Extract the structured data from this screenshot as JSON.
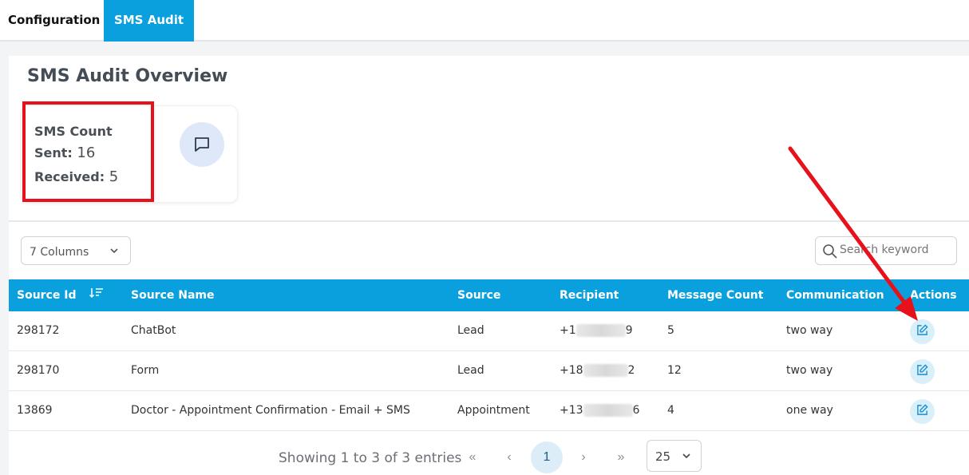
{
  "tabs": [
    {
      "label": "Configuration",
      "active": false
    },
    {
      "label": "SMS Audit",
      "active": true
    }
  ],
  "overview": {
    "title": "SMS Audit Overview",
    "card": {
      "heading": "SMS Count",
      "sent_label": "Sent:",
      "sent_value": "16",
      "received_label": "Received:",
      "received_value": "5",
      "icon": "message-icon"
    }
  },
  "toolbar": {
    "columns_label": "7 Columns",
    "search_placeholder": "Search keyword"
  },
  "table": {
    "headers": [
      "Source Id",
      "Source Name",
      "Source",
      "Recipient",
      "Message Count",
      "Communication",
      "Actions"
    ],
    "rows": [
      {
        "source_id": "298172",
        "source_name": "ChatBot",
        "source": "Lead",
        "recipient_prefix": "+1",
        "recipient_suffix": "9",
        "message_count": "5",
        "communication": "two way"
      },
      {
        "source_id": "298170",
        "source_name": "Form",
        "source": "Lead",
        "recipient_prefix": "+18",
        "recipient_suffix": "2",
        "message_count": "12",
        "communication": "two way"
      },
      {
        "source_id": "13869",
        "source_name": "Doctor - Appointment Confirmation - Email + SMS",
        "source": "Appointment",
        "recipient_prefix": "+13",
        "recipient_suffix": "6",
        "message_count": "4",
        "communication": "one way"
      }
    ]
  },
  "pagination": {
    "showing": "Showing 1 to 3 of 3 entries",
    "first": "«",
    "prev": "‹",
    "current": "1",
    "next": "›",
    "last": "»",
    "page_size": "25"
  },
  "colors": {
    "accent": "#0aa0dd",
    "annotation_red": "#e8101a"
  }
}
